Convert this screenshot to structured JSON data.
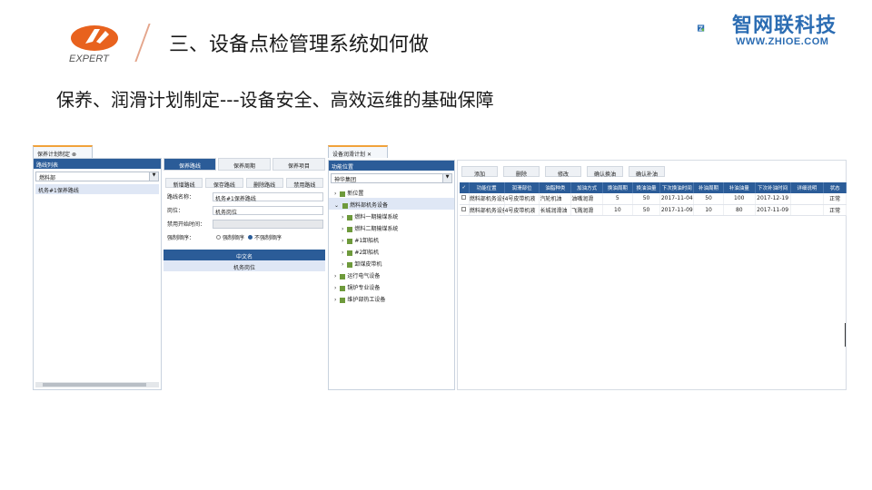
{
  "header": {
    "title": "三、设备点检管理系统如何做",
    "brand_name": "智网联科技",
    "brand_url": "WWW.ZHIOE.COM",
    "logo_text": "EXPERT"
  },
  "subtitle": "保养、润滑计划制定---设备安全、高效运维的基础保障",
  "panel1": {
    "tab_label": "保养计划制定",
    "sidebar": {
      "header": "路线列表",
      "select_value": "燃料部",
      "items": [
        "机务#1保养路线"
      ]
    },
    "form_tabs": [
      "保养路线",
      "保养周期",
      "保养项目"
    ],
    "buttons": [
      "新增路线",
      "保存路线",
      "删除路线",
      "禁用路线"
    ],
    "fields": [
      {
        "label": "路线名称：",
        "value": "机务#1保养路线"
      },
      {
        "label": "岗位：",
        "value": "机务岗位"
      },
      {
        "label": "禁用开始时间：",
        "value": ""
      }
    ],
    "force_label": "强制顺序：",
    "radios": [
      "强制顺序",
      "不强制顺序"
    ],
    "grid_header": "中文名",
    "grid_row": "机务岗位"
  },
  "panel2": {
    "tab_label": "设备润滑计划",
    "tree_header": "功能位置",
    "select_value": "神华集团",
    "tree": [
      "新位置",
      "燃料部机务设备",
      "燃料一期输煤系统",
      "燃料二期输煤系统",
      "#1卸船机",
      "#2卸船机",
      "卸煤皮带机",
      "运行电气设备",
      "锅炉专业设备",
      "维护部热工设备"
    ],
    "toolbar": [
      "添加",
      "删除",
      "修改",
      "确认换油",
      "确认补油"
    ],
    "columns": [
      "功能位置",
      "润滑部位",
      "油脂种类",
      "加油方式",
      "换油周期",
      "换油油量",
      "下次换油时间",
      "补油周期",
      "补油油量",
      "下次补油时间",
      "详细说明",
      "状态"
    ],
    "rows": [
      [
        "燃料部机务设备",
        "4号皮带机液",
        "汽轮机油",
        "油嘴润滑",
        "5",
        "50",
        "2017-11-04",
        "50",
        "100",
        "2017-12-19",
        "",
        "正常"
      ],
      [
        "燃料部机务设备",
        "4号皮带机液",
        "长城润滑油",
        "飞溅润滑",
        "10",
        "50",
        "2017-11-09",
        "10",
        "80",
        "2017-11-09",
        "",
        "正常"
      ]
    ]
  }
}
